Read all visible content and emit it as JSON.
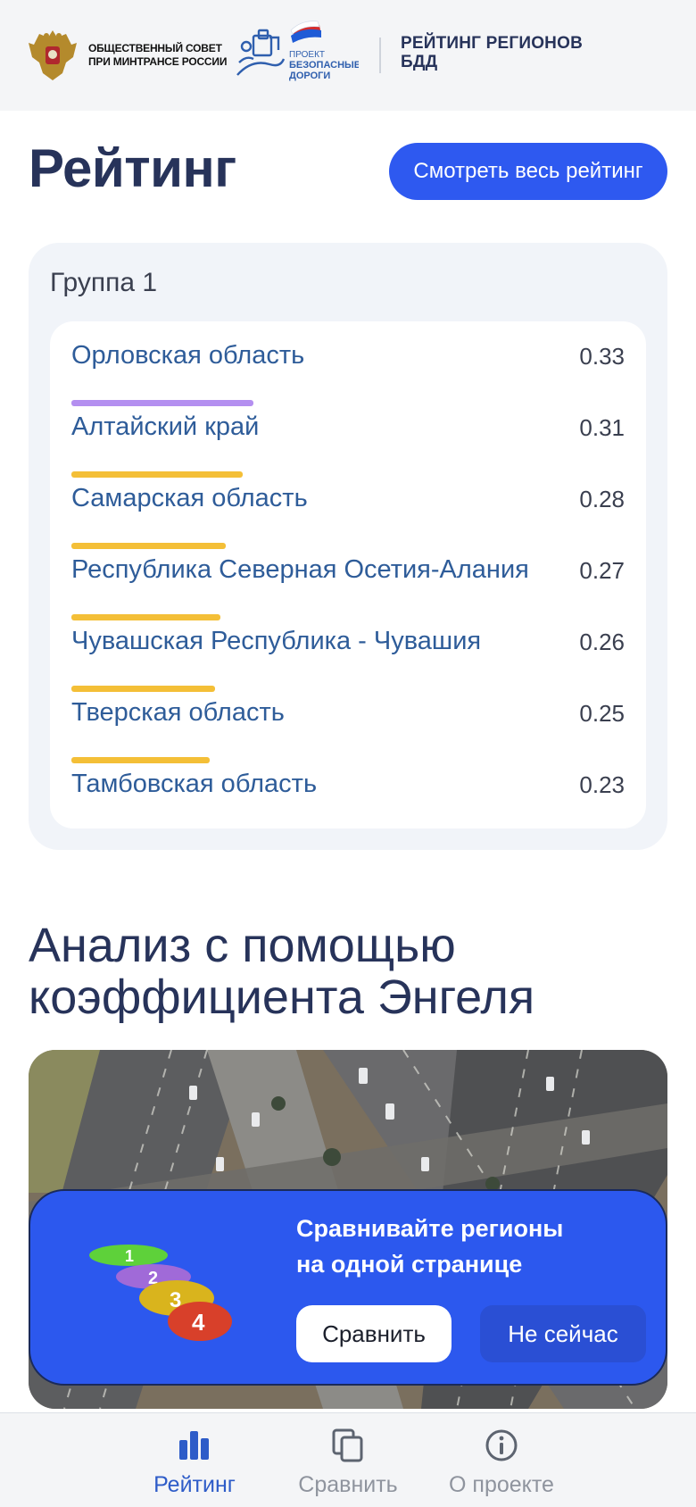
{
  "header": {
    "org_line1": "ОБЩЕСТВЕННЫЙ СОВЕТ",
    "org_line2": "ПРИ МИНТРАНСЕ РОССИИ",
    "project_line1": "ПРОЕКТ",
    "project_line2": "БЕЗОПАСНЫЕ",
    "project_line3": "ДОРОГИ",
    "title_line1": "РЕЙТИНГ РЕГИОНОВ",
    "title_line2": "БДД"
  },
  "rating": {
    "title": "Рейтинг",
    "view_all_label": "Смотреть весь рейтинг",
    "group": {
      "title": "Группа 1",
      "rows": [
        {
          "name": "Орловская область",
          "value": "0.33",
          "bar_fraction": 0.33,
          "bar_color": "#b48ff0"
        },
        {
          "name": "Алтайский край",
          "value": "0.31",
          "bar_fraction": 0.31,
          "bar_color": "#f4bf37"
        },
        {
          "name": "Самарская область",
          "value": "0.28",
          "bar_fraction": 0.28,
          "bar_color": "#f4bf37"
        },
        {
          "name": "Республика Северная Осетия-Алания",
          "value": "0.27",
          "bar_fraction": 0.27,
          "bar_color": "#f4bf37"
        },
        {
          "name": "Чувашская Республика - Чувашия",
          "value": "0.26",
          "bar_fraction": 0.26,
          "bar_color": "#f4bf37"
        },
        {
          "name": "Тверская область",
          "value": "0.25",
          "bar_fraction": 0.25,
          "bar_color": "#f4bf37"
        },
        {
          "name": "Тамбовская область",
          "value": "0.23",
          "bar_fraction": 0.23,
          "bar_color": "#f4bf37"
        }
      ]
    }
  },
  "engel": {
    "title_line1": "Анализ с помощью",
    "title_line2": "коэффициента Энгеля"
  },
  "compare_banner": {
    "text_line1": "Сравнивайте регионы",
    "text_line2": "на одной странице",
    "compare_label": "Сравнить",
    "later_label": "Не сейчас",
    "chips": [
      "1",
      "2",
      "3",
      "4"
    ]
  },
  "bottom_nav": {
    "items": [
      {
        "label": "Рейтинг",
        "icon": "bar-chart-icon",
        "active": true
      },
      {
        "label": "Сравнить",
        "icon": "copy-icon",
        "active": false
      },
      {
        "label": "О проекте",
        "icon": "info-icon",
        "active": false
      }
    ]
  },
  "colors": {
    "accent": "#2e59f0",
    "title": "#27335a",
    "link": "#2e5c99",
    "nav_active": "#2e5cc8",
    "nav_inactive": "#8f949e"
  }
}
